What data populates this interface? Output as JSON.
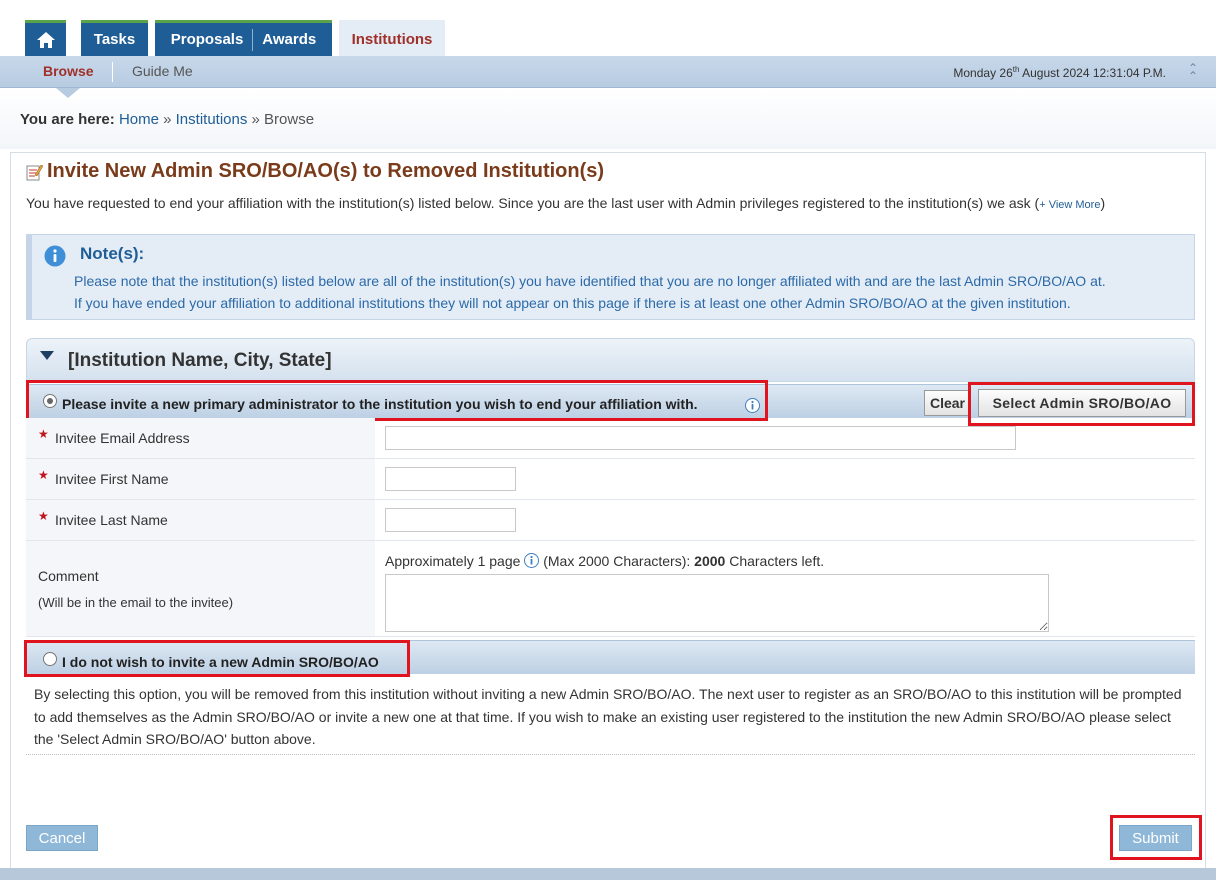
{
  "nav": {
    "tabs": [
      {
        "label": "Tasks"
      },
      {
        "label": "Proposals"
      },
      {
        "label": "Awards"
      },
      {
        "label": "Institutions"
      }
    ],
    "subtabs": [
      {
        "label": "Browse"
      },
      {
        "label": "Guide Me"
      }
    ],
    "datetime_prefix": "Monday 26",
    "datetime_sup": "th",
    "datetime_suffix": " August 2024 12:31:04 P.M."
  },
  "breadcrumb": {
    "prefix": "You are here:",
    "items": [
      "Home",
      "Institutions",
      "Browse"
    ],
    "sep": "»"
  },
  "page": {
    "title": "Invite New Admin SRO/BO/AO(s) to Removed Institution(s)",
    "intro": "You have requested to end your affiliation with the institution(s) listed below. Since you are the last user with Admin privileges registered to the institution(s) we ask (",
    "view_more": "+ View More",
    "intro_close": ")"
  },
  "note": {
    "title": "Note(s):",
    "line1": "Please note that the institution(s) listed below are all of the institution(s) you have identified that you are no longer affiliated with and are the last Admin SRO/BO/AO at.",
    "line2": "If you have ended your affiliation to additional institutions they will not appear on this page if there is at least one other Admin SRO/BO/AO at the given institution."
  },
  "institution": {
    "title": "[Institution Name, City, State]"
  },
  "option1": {
    "label": "Please invite a new primary administrator to the institution you wish to end your affiliation with.",
    "selected": true,
    "clear_label": "Clear",
    "select_label": "Select Admin SRO/BO/AO"
  },
  "form": {
    "email_label": "Invitee Email Address",
    "first_label": "Invitee First Name",
    "last_label": "Invitee Last Name",
    "comment_label": "Comment",
    "comment_sub": "(Will be in the email to the invitee)",
    "comment_hint_a": "Approximately 1 page ",
    "comment_hint_b": " (Max 2000 Characters): ",
    "chars_left": "2000",
    "chars_left_suffix": " Characters left."
  },
  "option2": {
    "label": "I do not wish to invite a new Admin SRO/BO/AO",
    "selected": false,
    "description": "By selecting this option, you will be removed from this institution without inviting a new Admin SRO/BO/AO. The next user to register as an SRO/BO/AO to this institution will be prompted to add themselves as the Admin SRO/BO/AO or invite a new one at that time. If you wish to make an existing user registered to the institution the new Admin SRO/BO/AO please select the 'Select Admin SRO/BO/AO' button above."
  },
  "actions": {
    "cancel_label": "Cancel",
    "submit_label": "Submit"
  },
  "colors": {
    "nav_blue": "#1f5d96",
    "title_brown": "#7a3b1a",
    "highlight_red": "#e0141e"
  }
}
